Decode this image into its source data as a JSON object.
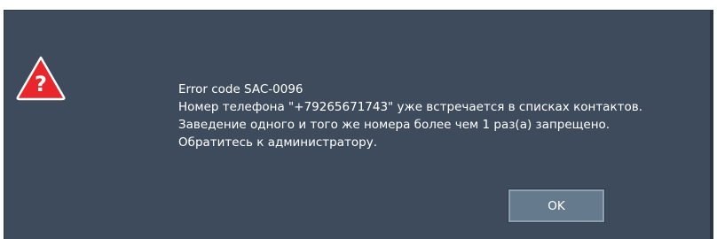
{
  "dialog": {
    "icon": "warning-question-icon",
    "icon_glyph": "?",
    "accent_color": "#e8262b",
    "background_color": "#3e4b5c",
    "message_lines": [
      "Error code SAC-0096",
      "Номер телефона \"+79265671743\" уже встречается в списках контактов.",
      "Заведение одного и того же номера более чем 1 раз(а) запрещено.",
      "Обратитесь к администратору."
    ],
    "ok_label": "OK"
  }
}
